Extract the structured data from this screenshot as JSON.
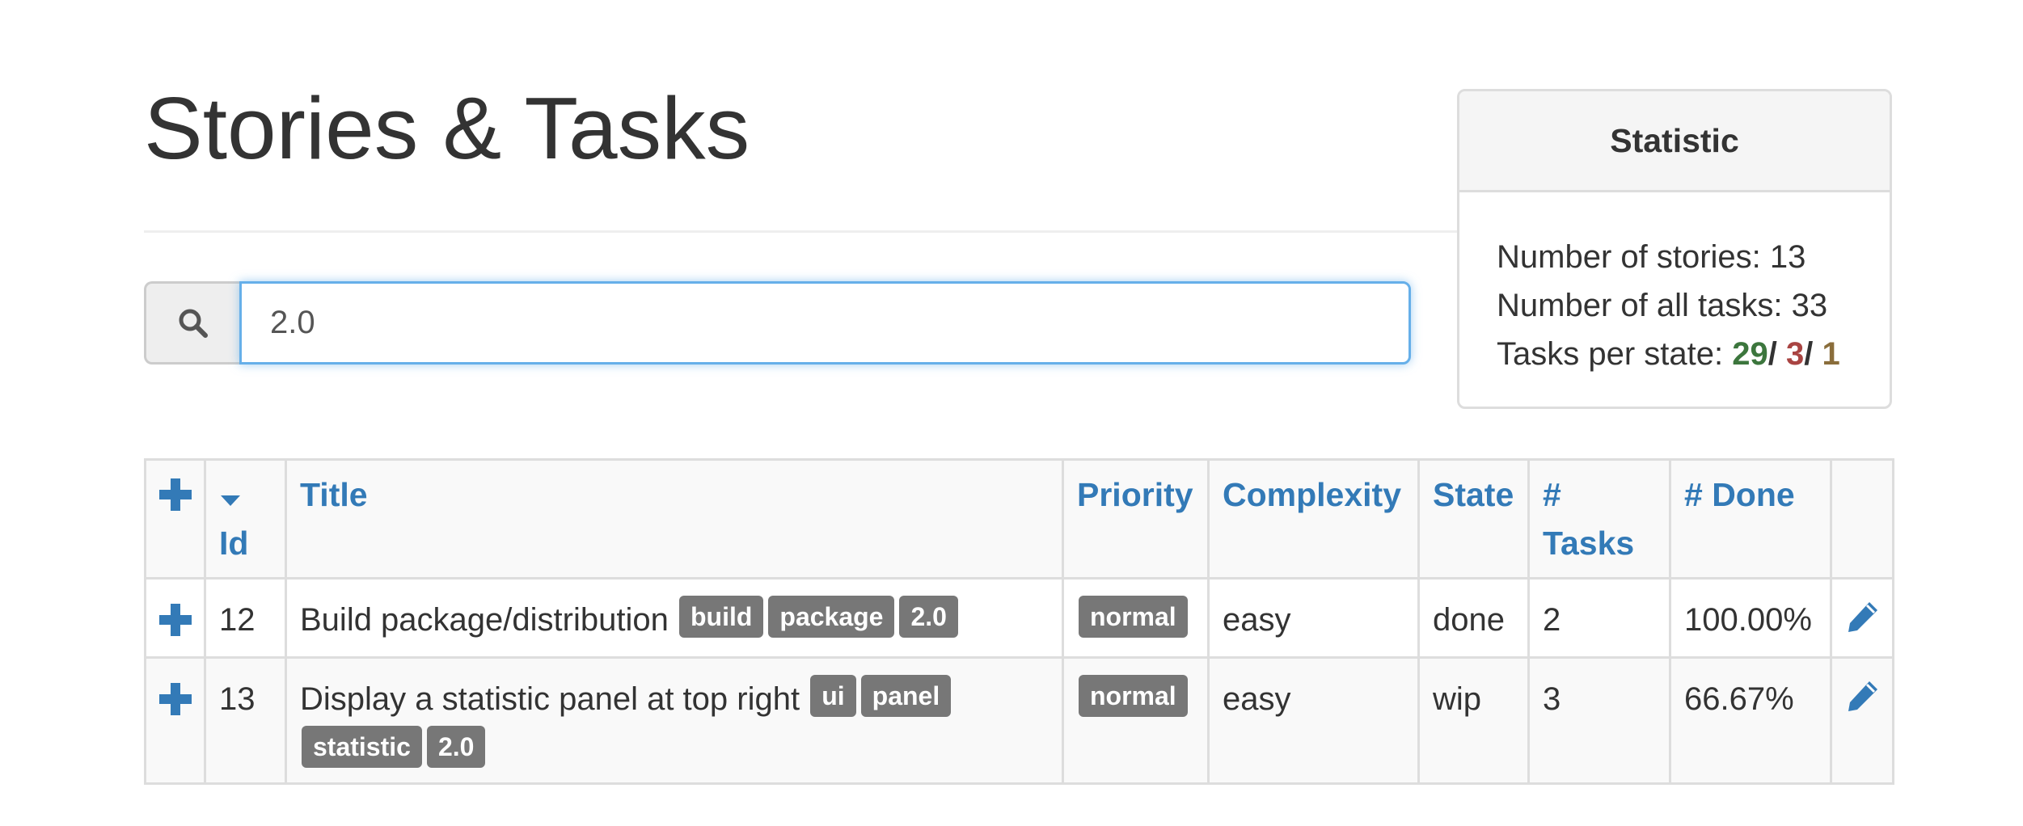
{
  "page": {
    "title": "Stories & Tasks"
  },
  "search": {
    "icon": "search-icon",
    "value": "2.0",
    "placeholder": ""
  },
  "statistic": {
    "heading": "Statistic",
    "stories_label": "Number of stories: ",
    "stories_count": "13",
    "tasks_label": "Number of all tasks: ",
    "tasks_count": "33",
    "per_state_label": "Tasks per state: ",
    "done_count": "29",
    "wip_count": "3",
    "todo_count": "1",
    "separator": "/",
    "colors": {
      "done": "#3c763d",
      "wip": "#a94442",
      "todo": "#8a6d3b"
    }
  },
  "table": {
    "headers": {
      "add": "plus-icon",
      "sort_icon": "caret-down-icon",
      "id": "Id",
      "title": "Title",
      "priority": "Priority",
      "complexity": "Complexity",
      "state": "State",
      "tasks_line1": "#",
      "tasks_line2": "Tasks",
      "done": "# Done"
    },
    "rows": [
      {
        "id": "12",
        "title": "Build package/distribution",
        "tags": [
          "build",
          "package",
          "2.0"
        ],
        "priority": "normal",
        "complexity": "easy",
        "state": "done",
        "tasks": "2",
        "done": "100.00%"
      },
      {
        "id": "13",
        "title": "Display a statistic panel at top right",
        "tags": [
          "ui",
          "panel",
          "statistic",
          "2.0"
        ],
        "priority": "normal",
        "complexity": "easy",
        "state": "wip",
        "tasks": "3",
        "done": "66.67%"
      }
    ]
  },
  "theme": {
    "link_color": "#337ab7",
    "label_bg": "#777777",
    "focus_border": "#66afe9"
  }
}
